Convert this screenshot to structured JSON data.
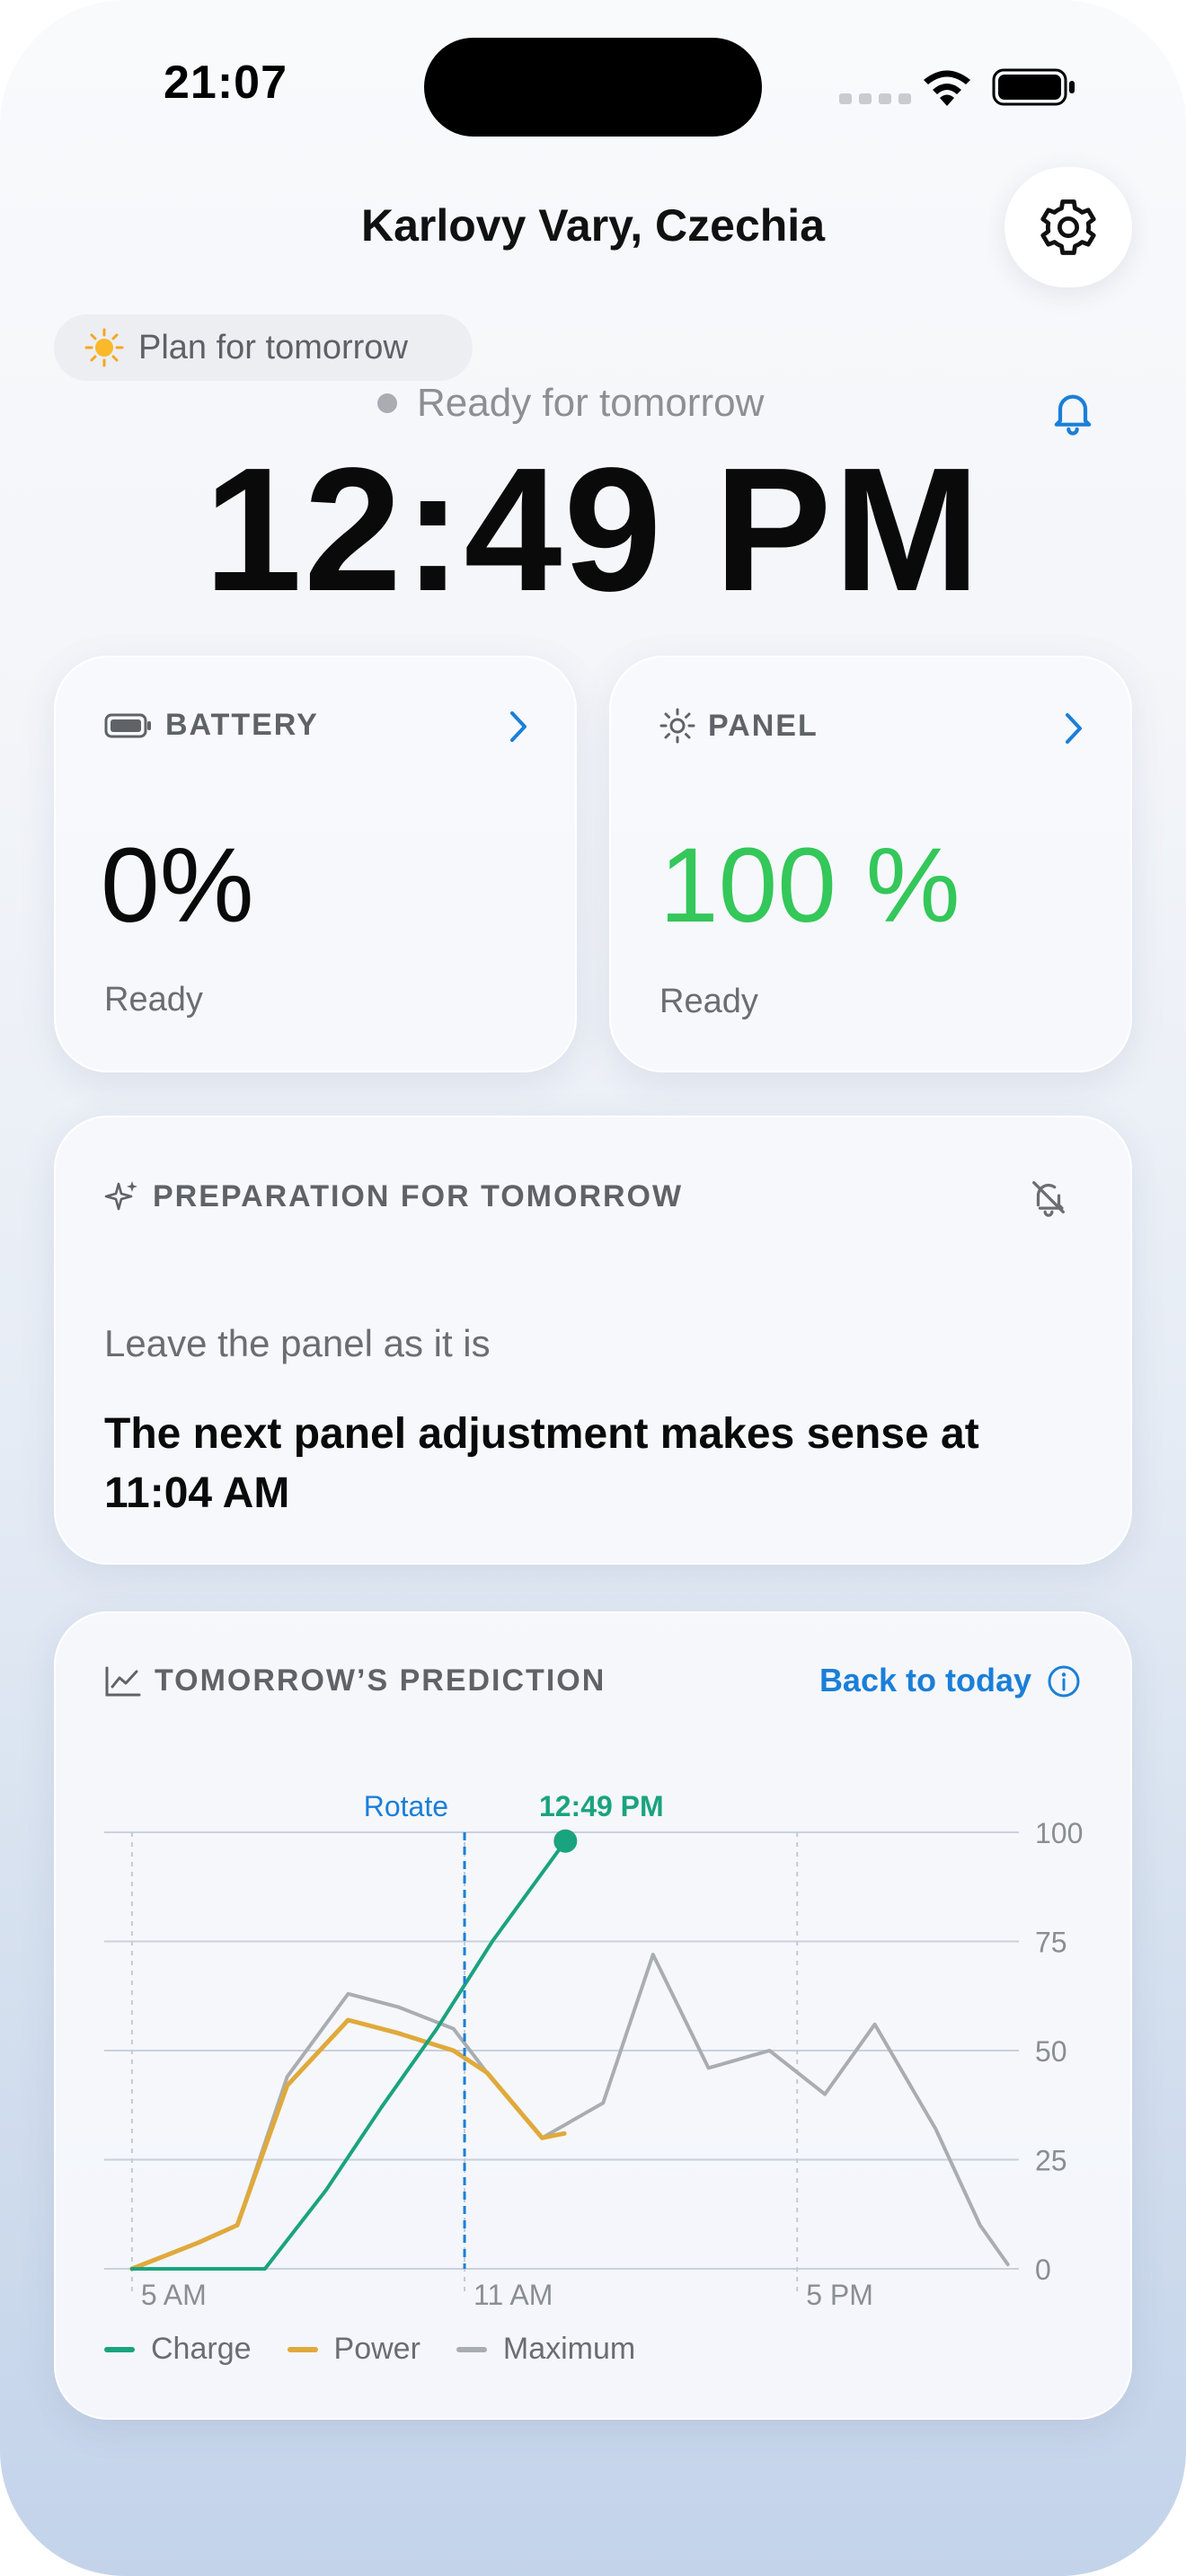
{
  "status_bar": {
    "time": "21:07"
  },
  "header": {
    "location": "Karlovy Vary, Czechia"
  },
  "plan_pill": {
    "label": "Plan for tomorrow"
  },
  "status": {
    "text": "Ready for tomorrow",
    "time": "12:49 PM"
  },
  "battery_card": {
    "title": "BATTERY",
    "value": "0%",
    "state": "Ready"
  },
  "panel_card": {
    "title": "PANEL",
    "value": "100 %",
    "state": "Ready"
  },
  "prep_card": {
    "title": "PREPARATION FOR TOMORROW",
    "action": "Leave the panel as it is",
    "detail": "The next panel adjustment makes sense at 11:04 AM"
  },
  "prediction_card": {
    "title": "TOMORROW’S PREDICTION",
    "back_link": "Back to today"
  },
  "colors": {
    "charge": "#1aa37f",
    "power": "#e0a93b",
    "maximum": "#a9adb2",
    "accent": "#1a7fd8",
    "green": "#34c759"
  },
  "chart_data": {
    "type": "line",
    "x_ticks": [
      "5 AM",
      "11 AM",
      "5 PM"
    ],
    "y_ticks": [
      "0",
      "25",
      "50",
      "75",
      "100"
    ],
    "ylim": [
      0,
      100
    ],
    "xlim_hours": [
      4.5,
      21
    ],
    "markers": [
      {
        "label": "Rotate",
        "x": 11.0
      },
      {
        "label": "12:49 PM",
        "x": 12.82
      }
    ],
    "series": [
      {
        "name": "Charge",
        "color": "#1aa37f",
        "points": [
          [
            5.0,
            0
          ],
          [
            7.4,
            0
          ],
          [
            8.5,
            18
          ],
          [
            9.5,
            37
          ],
          [
            10.5,
            55
          ],
          [
            11.5,
            75
          ],
          [
            12.82,
            98
          ]
        ]
      },
      {
        "name": "Power",
        "color": "#e0a93b",
        "points": [
          [
            5.0,
            0
          ],
          [
            6.2,
            6
          ],
          [
            6.9,
            10
          ],
          [
            7.8,
            42
          ],
          [
            8.9,
            57
          ],
          [
            9.8,
            54
          ],
          [
            10.8,
            50
          ],
          [
            11.4,
            45
          ],
          [
            12.4,
            30
          ],
          [
            12.8,
            31
          ]
        ]
      },
      {
        "name": "Maximum",
        "color": "#a9adb2",
        "points": [
          [
            5.0,
            0
          ],
          [
            6.2,
            6
          ],
          [
            6.9,
            10
          ],
          [
            7.8,
            44
          ],
          [
            8.9,
            63
          ],
          [
            9.8,
            60
          ],
          [
            10.8,
            55
          ],
          [
            11.4,
            45
          ],
          [
            12.4,
            30
          ],
          [
            13.5,
            38
          ],
          [
            14.4,
            72
          ],
          [
            15.4,
            46
          ],
          [
            16.5,
            50
          ],
          [
            17.5,
            40
          ],
          [
            18.4,
            56
          ],
          [
            19.5,
            32
          ],
          [
            20.3,
            10
          ],
          [
            20.8,
            1
          ]
        ]
      }
    ]
  }
}
